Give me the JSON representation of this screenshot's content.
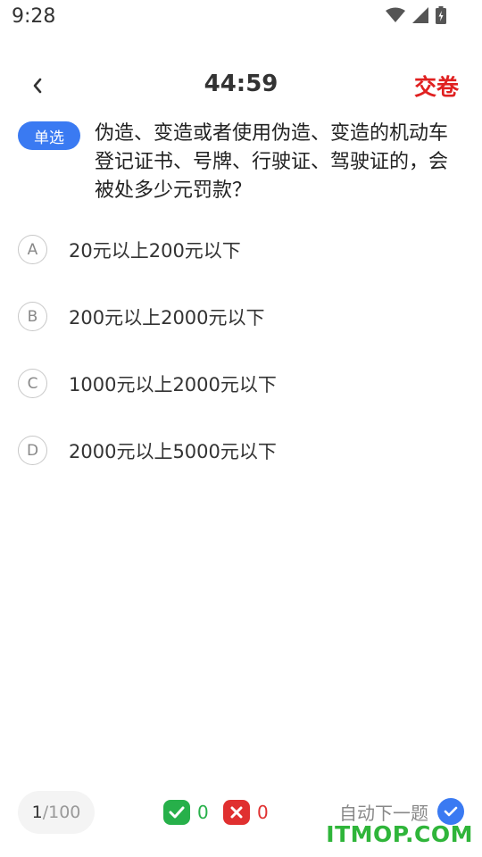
{
  "status_bar": {
    "time": "9:28"
  },
  "header": {
    "timer": "44:59",
    "submit_label": "交卷"
  },
  "question": {
    "type_label": "单选",
    "text": "伪造、变造或者使用伪造、变造的机动车登记证书、号牌、行驶证、驾驶证的，会被处多少元罚款？"
  },
  "options": [
    {
      "letter": "A",
      "text": "20元以上200元以下"
    },
    {
      "letter": "B",
      "text": "200元以上2000元以下"
    },
    {
      "letter": "C",
      "text": "1000元以上2000元以下"
    },
    {
      "letter": "D",
      "text": "2000元以上5000元以下"
    }
  ],
  "bottom": {
    "progress_current": "1",
    "progress_total": "/100",
    "correct_count": "0",
    "wrong_count": "0",
    "auto_next_label": "自动下一题"
  },
  "watermark": "ITMOP.COM",
  "colors": {
    "accent": "#3a7af2",
    "submit": "#e02020",
    "correct": "#27b04a",
    "wrong": "#e03030"
  }
}
